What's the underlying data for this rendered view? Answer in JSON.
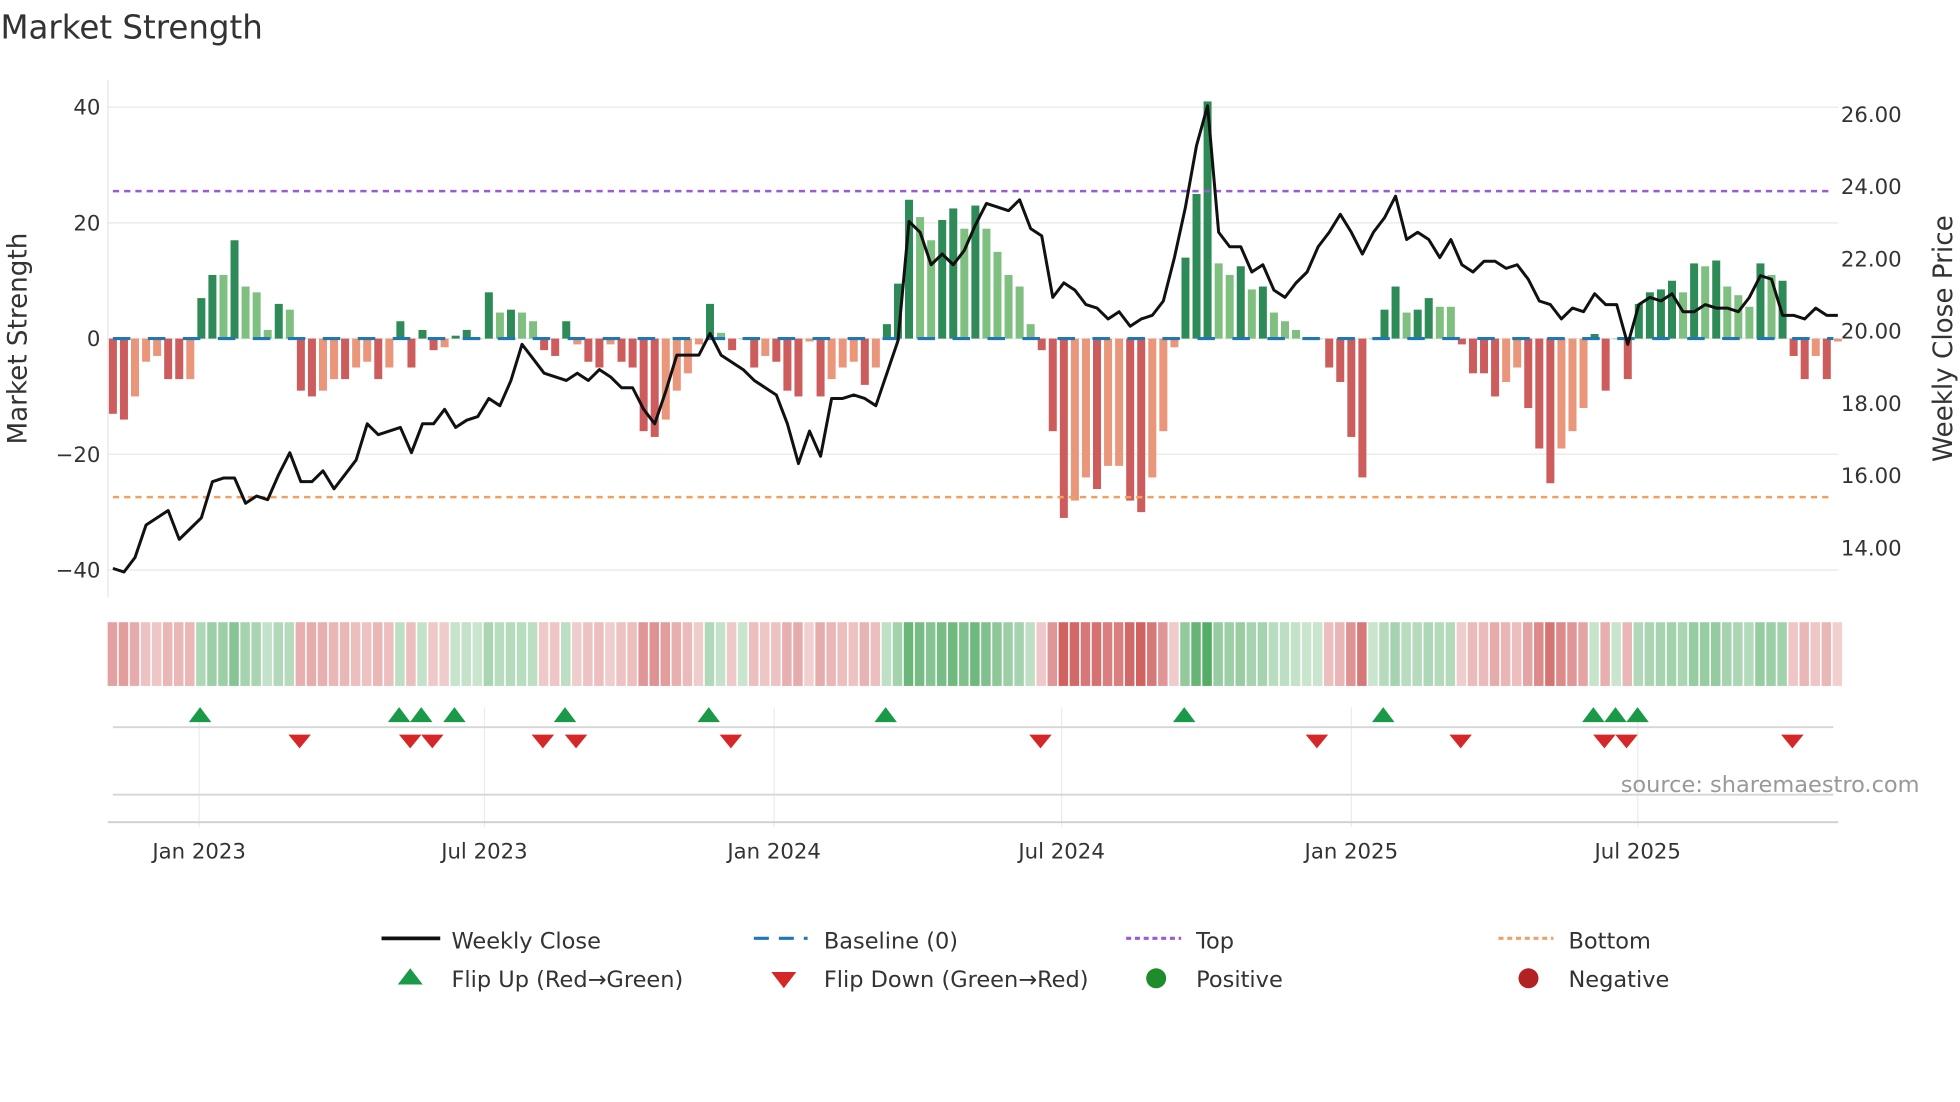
{
  "chart_data": {
    "type": "bar",
    "title": "Market Strength",
    "ylabel": "Market Strength",
    "y2label": "Weekly Close Price",
    "ylim": [
      -44,
      44.5
    ],
    "y2lim": [
      13.2,
      26.7
    ],
    "yticks": [
      "40",
      "20",
      "0",
      "−20",
      "−40"
    ],
    "ytick_values": [
      40,
      20,
      0,
      -20,
      -40
    ],
    "y2ticks": [
      "26.00",
      "24.00",
      "22.00",
      "20.00",
      "18.00",
      "16.00",
      "14.00"
    ],
    "y2tick_values": [
      26,
      24,
      22,
      20,
      18,
      16,
      14
    ],
    "xticks": [
      {
        "label": "Jan 2023",
        "week": 7.8
      },
      {
        "label": "Jul 2023",
        "week": 33.6
      },
      {
        "label": "Jan 2024",
        "week": 59.8
      },
      {
        "label": "Jul 2024",
        "week": 85.8
      },
      {
        "label": "Jan 2025",
        "week": 112
      },
      {
        "label": "Jul 2025",
        "week": 137.9
      }
    ],
    "top": 25.5,
    "bottom": -27.4,
    "baseline": 0,
    "strength": [
      -13,
      -14,
      -10,
      -4,
      -3,
      -7,
      -7,
      -7,
      7,
      11,
      11,
      17,
      9,
      8,
      1.5,
      6,
      5,
      -9,
      -10,
      -9,
      -7,
      -7,
      -5,
      -4,
      -7,
      -5,
      3,
      -5,
      1.5,
      -2,
      -1.5,
      0.5,
      1.5,
      0,
      8,
      4.5,
      5,
      4.5,
      3,
      -2,
      -3,
      3,
      -1,
      -4,
      -5,
      -1,
      -4,
      -5,
      -16,
      -17,
      -14,
      -9,
      -6,
      -1,
      6,
      1,
      -2,
      0,
      -5,
      -3,
      -4,
      -9,
      -10,
      -0.5,
      -10,
      -7,
      -5,
      -4,
      -8,
      -5,
      2.5,
      9.5,
      24,
      21,
      17,
      20.5,
      22.5,
      19,
      23,
      19,
      15,
      11,
      9,
      2.5,
      -2,
      -16,
      -31,
      -28,
      -24,
      -26,
      -22,
      -22,
      -28,
      -30,
      -24,
      -16,
      -1.5,
      14,
      25,
      41,
      13,
      11,
      12.5,
      8.5,
      9,
      4.5,
      3,
      1.5,
      0,
      0,
      -5,
      -7.5,
      -17,
      -24,
      0,
      5,
      9,
      4.5,
      5,
      7,
      5.5,
      5.5,
      -1,
      -6,
      -6,
      -10,
      -7.5,
      -5,
      -12,
      -19,
      -25,
      -19,
      -16,
      -12,
      0.8,
      -9,
      0,
      -7,
      6,
      8,
      8.5,
      10,
      8,
      13,
      12.5,
      13.5,
      9,
      7.5,
      5.5,
      13,
      11,
      10,
      -3,
      -7,
      -3,
      -7,
      -0.5
    ],
    "strong": [
      1,
      1,
      0,
      0,
      0,
      1,
      1,
      0,
      1,
      1,
      0,
      1,
      0,
      0,
      0,
      1,
      0,
      1,
      1,
      0,
      0,
      1,
      0,
      0,
      1,
      0,
      1,
      1,
      1,
      1,
      0,
      1,
      1,
      0,
      1,
      0,
      1,
      0,
      0,
      1,
      1,
      1,
      0,
      1,
      1,
      0,
      1,
      1,
      1,
      1,
      0,
      0,
      0,
      0,
      1,
      0,
      1,
      0,
      1,
      0,
      1,
      1,
      1,
      0,
      1,
      0,
      0,
      0,
      1,
      0,
      1,
      1,
      1,
      0,
      0,
      1,
      1,
      0,
      1,
      0,
      0,
      0,
      0,
      0,
      1,
      1,
      1,
      0,
      0,
      1,
      0,
      0,
      1,
      1,
      0,
      0,
      0,
      1,
      1,
      1,
      0,
      0,
      1,
      0,
      1,
      0,
      0,
      0,
      0,
      0,
      1,
      1,
      1,
      1,
      0,
      1,
      1,
      0,
      1,
      1,
      0,
      0,
      1,
      1,
      1,
      1,
      0,
      0,
      1,
      1,
      1,
      0,
      0,
      0,
      1,
      1,
      0,
      1,
      1,
      1,
      1,
      1,
      0,
      1,
      0,
      1,
      0,
      0,
      0,
      1,
      0,
      1,
      1,
      1,
      0,
      1,
      0
    ],
    "close": [
      13.4,
      13.3,
      13.7,
      14.6,
      14.8,
      15.0,
      14.2,
      14.5,
      14.8,
      15.8,
      15.9,
      15.9,
      15.2,
      15.4,
      15.3,
      16.0,
      16.6,
      15.8,
      15.8,
      16.1,
      15.6,
      16.0,
      16.4,
      17.4,
      17.1,
      17.2,
      17.3,
      16.6,
      17.4,
      17.4,
      17.8,
      17.3,
      17.5,
      17.6,
      18.1,
      17.9,
      18.6,
      19.6,
      19.2,
      18.8,
      18.7,
      18.6,
      18.8,
      18.6,
      18.9,
      18.7,
      18.4,
      18.4,
      17.8,
      17.4,
      18.3,
      19.3,
      19.3,
      19.3,
      19.9,
      19.3,
      19.1,
      18.9,
      18.6,
      18.4,
      18.2,
      17.4,
      16.3,
      17.2,
      16.5,
      18.1,
      18.1,
      18.2,
      18.1,
      17.9,
      18.8,
      19.7,
      23.0,
      22.7,
      21.8,
      22.1,
      21.8,
      22.2,
      22.9,
      23.5,
      23.4,
      23.3,
      23.6,
      22.8,
      22.6,
      20.9,
      21.3,
      21.1,
      20.7,
      20.6,
      20.3,
      20.5,
      20.1,
      20.3,
      20.4,
      20.8,
      22.0,
      23.4,
      25.1,
      26.2,
      22.7,
      22.3,
      22.3,
      21.6,
      21.8,
      21.1,
      20.9,
      21.3,
      21.6,
      22.3,
      22.7,
      23.2,
      22.7,
      22.1,
      22.7,
      23.1,
      23.7,
      22.5,
      22.7,
      22.5,
      22.0,
      22.5,
      21.8,
      21.6,
      21.9,
      21.9,
      21.7,
      21.8,
      21.4,
      20.8,
      20.7,
      20.3,
      20.6,
      20.5,
      21.0,
      20.7,
      20.7,
      19.6,
      20.7,
      20.9,
      20.8,
      21.0,
      20.5,
      20.5,
      20.7,
      20.6,
      20.6,
      20.5,
      20.9,
      21.5,
      21.4,
      20.4,
      20.4,
      20.3,
      20.6,
      20.4,
      20.4
    ],
    "flip_up_weeks": [
      8,
      26,
      28,
      31,
      41,
      54,
      70,
      97,
      115,
      134,
      136,
      138
    ],
    "flip_down_weeks": [
      17,
      27,
      29,
      39,
      42,
      56,
      84,
      109,
      122,
      135,
      137,
      152
    ],
    "legend": {
      "weekly_close": "Weekly Close",
      "baseline": "Baseline (0)",
      "top": "Top",
      "bottom": "Bottom",
      "flip_up": "Flip Up (Red→Green)",
      "flip_down": "Flip Down (Green→Red)",
      "positive": "Positive",
      "negative": "Negative"
    },
    "legend_placement": "bottom",
    "grid": true
  },
  "source": "source: sharemaestro.com",
  "colors": {
    "pos_strong": "#2e8b57",
    "pos_weak": "#7fbf7f",
    "neg_strong": "#cd5c5c",
    "neg_weak": "#e9967a",
    "top": "#9b59d6",
    "bottom": "#f0a060",
    "baseline": "#1f77b4",
    "flip_up": "#1a9a48",
    "flip_down": "#d62728",
    "positive": "#1e8c2a",
    "negative": "#b22222"
  }
}
